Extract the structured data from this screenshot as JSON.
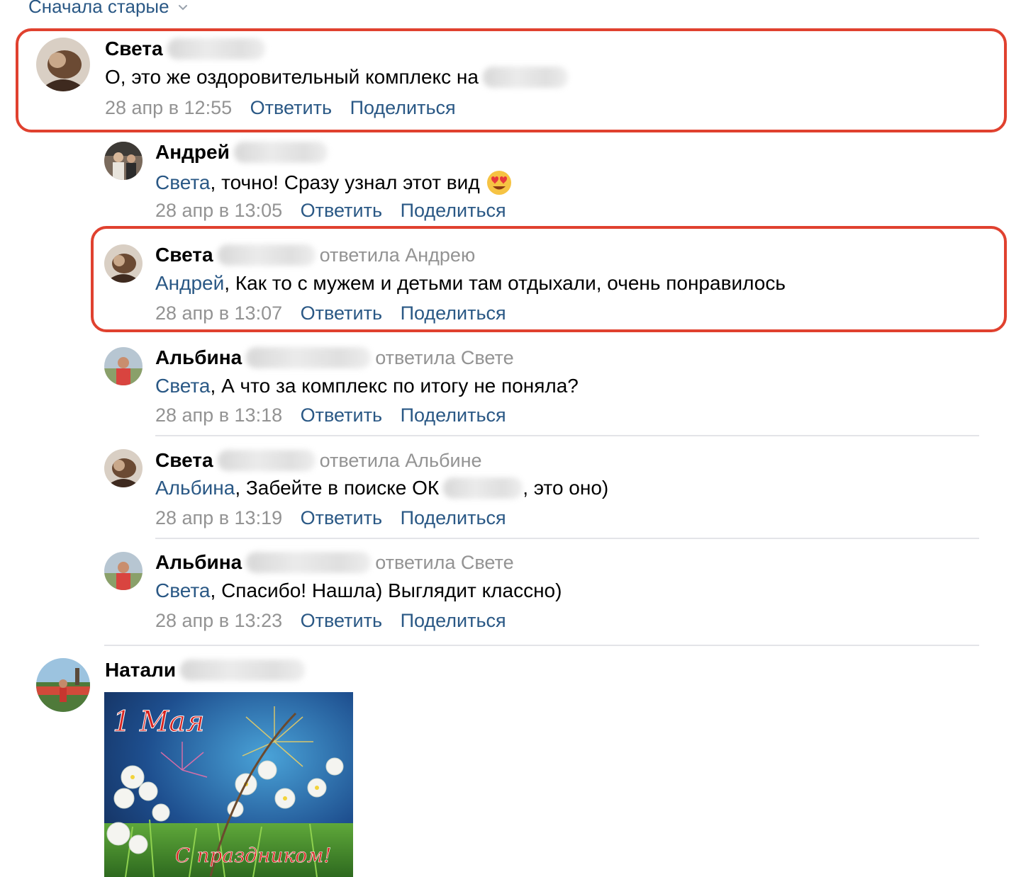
{
  "sort": {
    "label": "Сначала старые"
  },
  "comments": [
    {
      "author": "Света",
      "replied_to": "",
      "mention": "",
      "text": "О, это же оздоровительный комплекс на",
      "text_after": "",
      "date": "28 апр в 12:55",
      "reply_label": "Ответить",
      "share_label": "Поделиться"
    },
    {
      "author": "Андрей",
      "replied_to": "",
      "mention": "Света",
      "text": ", точно! Сразу узнал этот вид",
      "text_after": "",
      "date": "28 апр в 13:05",
      "reply_label": "Ответить",
      "share_label": "Поделиться"
    },
    {
      "author": "Света",
      "replied_to": "ответила Андрею",
      "mention": "Андрей",
      "text": ", Как то с мужем и детьми там отдыхали, очень понравилось",
      "text_after": "",
      "date": "28 апр в 13:07",
      "reply_label": "Ответить",
      "share_label": "Поделиться"
    },
    {
      "author": "Альбина",
      "replied_to": "ответила Свете",
      "mention": "Света",
      "text": ", А что за комплекс по итогу не поняла?",
      "text_after": "",
      "date": "28 апр в 13:18",
      "reply_label": "Ответить",
      "share_label": "Поделиться"
    },
    {
      "author": "Света",
      "replied_to": "ответила Альбине",
      "mention": "Альбина",
      "text": ", Забейте в поиске ОК",
      "text_after": ", это оно)",
      "date": "28 апр в 13:19",
      "reply_label": "Ответить",
      "share_label": "Поделиться"
    },
    {
      "author": "Альбина",
      "replied_to": "ответила Свете",
      "mention": "Света",
      "text": ", Спасибо! Нашла) Выглядит классно)",
      "text_after": "",
      "date": "28 апр в 13:23",
      "reply_label": "Ответить",
      "share_label": "Поделиться"
    },
    {
      "author": "Натали",
      "attachment": {
        "title_text": "1 Мая",
        "greeting_text": "С праздником!"
      }
    }
  ],
  "colors": {
    "link": "#2a5885",
    "muted": "#939393",
    "highlight": "#e0412f"
  },
  "icons": {
    "sort_chevron": "chevron-down-icon",
    "emoji": "heart-eyes-emoji-icon"
  }
}
